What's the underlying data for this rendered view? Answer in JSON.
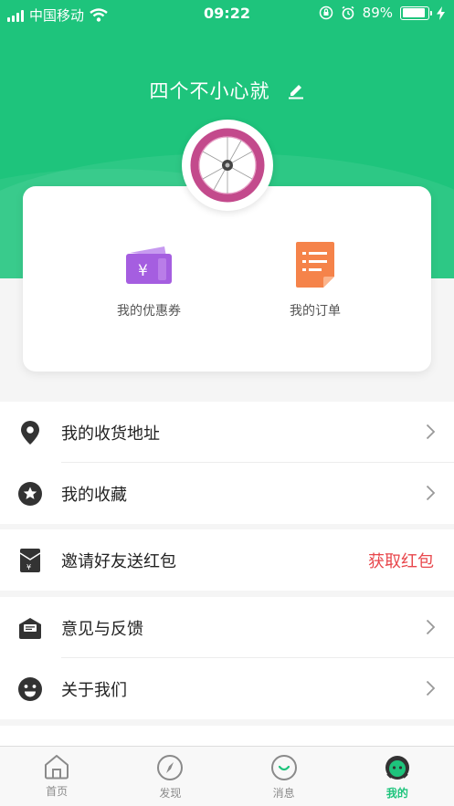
{
  "status_bar": {
    "carrier": "中国移动",
    "time": "09:22",
    "battery_percent": "89%",
    "battery_level": 0.89
  },
  "profile": {
    "username": "四个不小心就"
  },
  "card": {
    "coupon_label": "我的优惠券",
    "order_label": "我的订单"
  },
  "menu": {
    "address": "我的收货地址",
    "favorites": "我的收藏",
    "invite": "邀请好友送红包",
    "invite_action": "获取红包",
    "feedback": "意见与反馈",
    "about": "关于我们"
  },
  "tabs": [
    {
      "label": "首页"
    },
    {
      "label": "发现"
    },
    {
      "label": "消息"
    },
    {
      "label": "我的"
    }
  ],
  "colors": {
    "brand_green": "#1ec47c",
    "red_action": "#e8474c",
    "coupon_purple": "#a55ee0",
    "order_orange": "#f5834a"
  }
}
